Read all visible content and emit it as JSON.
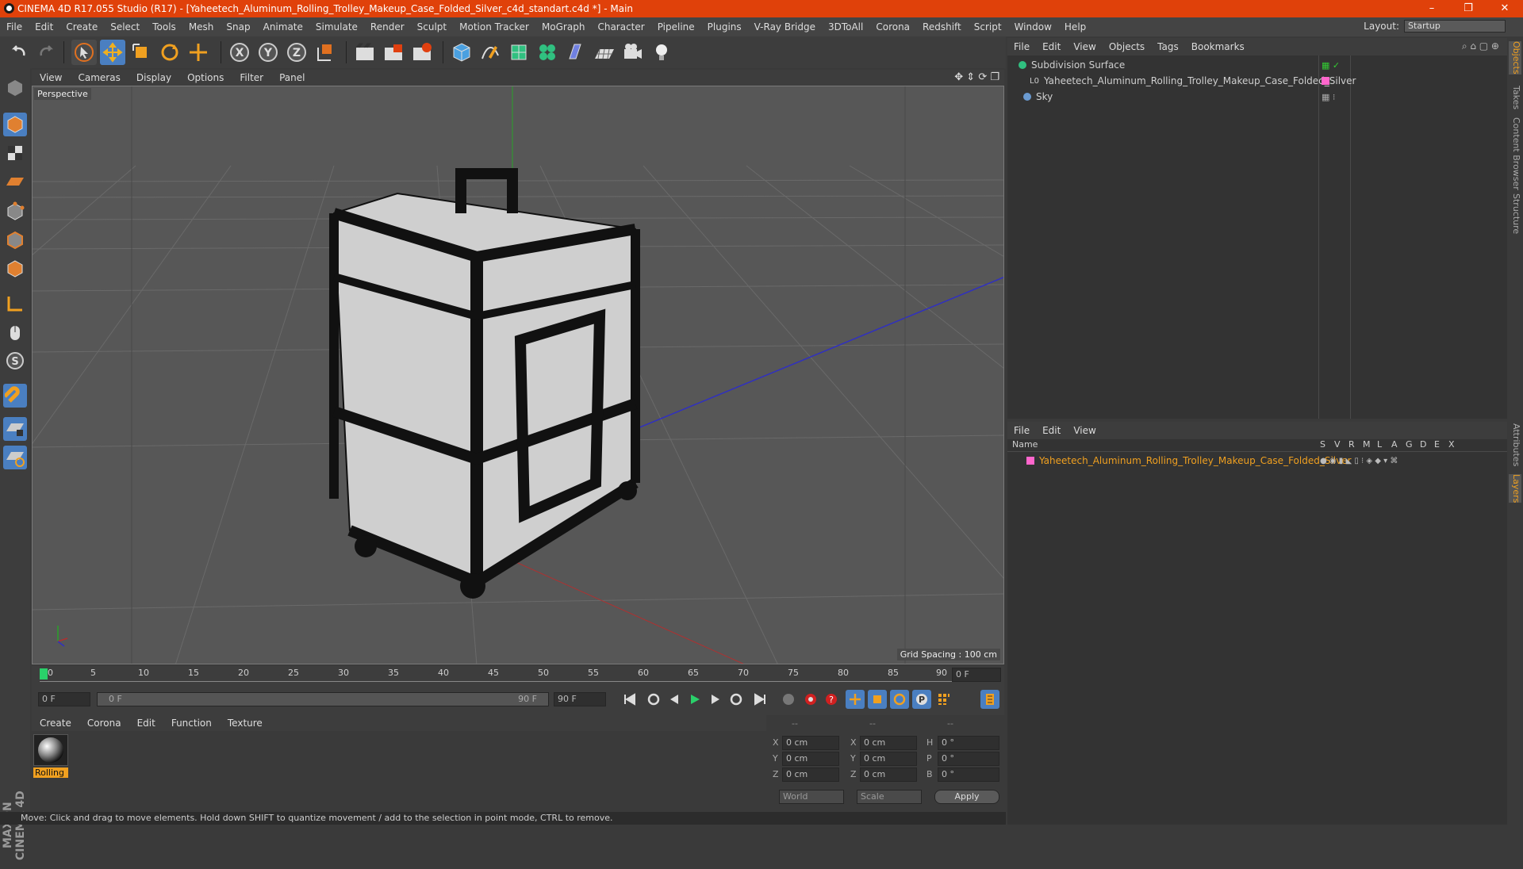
{
  "window": {
    "title": "CINEMA 4D R17.055 Studio (R17) - [Yaheetech_Aluminum_Rolling_Trolley_Makeup_Case_Folded_Silver_c4d_standart.c4d *] - Main",
    "minimize": "–",
    "restore": "❐",
    "close": "✕"
  },
  "menubar": {
    "items": [
      "File",
      "Edit",
      "Create",
      "Select",
      "Tools",
      "Mesh",
      "Snap",
      "Animate",
      "Simulate",
      "Render",
      "Sculpt",
      "Motion Tracker",
      "MoGraph",
      "Character",
      "Pipeline",
      "Plugins",
      "V-Ray Bridge",
      "3DToAll",
      "Corona",
      "Redshift",
      "Script",
      "Window",
      "Help"
    ],
    "layout_label": "Layout:",
    "layout_value": "Startup"
  },
  "viewport": {
    "menu": [
      "View",
      "Cameras",
      "Display",
      "Options",
      "Filter",
      "Panel"
    ],
    "camera_label": "Perspective",
    "grid_spacing": "Grid Spacing : 100 cm"
  },
  "timeline": {
    "ticks": [
      "0",
      "5",
      "10",
      "15",
      "20",
      "25",
      "30",
      "35",
      "40",
      "45",
      "50",
      "55",
      "60",
      "65",
      "70",
      "75",
      "80",
      "85",
      "90"
    ],
    "end_frame_field": "0 F"
  },
  "playback": {
    "current_frame": "0 F",
    "range_start": "0 F",
    "range_end": "90 F",
    "max_frame": "90 F"
  },
  "material_manager": {
    "menu": [
      "Create",
      "Corona",
      "Edit",
      "Function",
      "Texture"
    ],
    "materials": [
      {
        "name": "Rolling"
      }
    ]
  },
  "coordinates": {
    "headers": [
      "--",
      "--",
      "--"
    ],
    "rows": [
      {
        "a_label": "X",
        "a_val": "0 cm",
        "b_label": "X",
        "b_val": "0 cm",
        "c_label": "H",
        "c_val": "0 °"
      },
      {
        "a_label": "Y",
        "a_val": "0 cm",
        "b_label": "Y",
        "b_val": "0 cm",
        "c_label": "P",
        "c_val": "0 °"
      },
      {
        "a_label": "Z",
        "a_val": "0 cm",
        "b_label": "Z",
        "b_val": "0 cm",
        "c_label": "B",
        "c_val": "0 °"
      }
    ],
    "mode1": "World",
    "mode2": "Scale",
    "apply": "Apply"
  },
  "status": "Move: Click and drag to move elements. Hold down SHIFT to quantize movement / add to the selection in point mode, CTRL to remove.",
  "object_manager": {
    "menu": [
      "File",
      "Edit",
      "View",
      "Objects",
      "Tags",
      "Bookmarks"
    ],
    "objects": [
      {
        "name": "Subdivision Surface",
        "color": "#ccc"
      },
      {
        "name": "Yaheetech_Aluminum_Rolling_Trolley_Makeup_Case_Folded_Silver",
        "color": "#ddd"
      },
      {
        "name": "Sky",
        "color": "#ccc"
      }
    ]
  },
  "layer_manager": {
    "menu": [
      "File",
      "Edit",
      "View"
    ],
    "columns": [
      "Name",
      "S",
      "V",
      "R",
      "M",
      "L",
      "A",
      "G",
      "D",
      "E",
      "X"
    ],
    "layers": [
      {
        "name": "Yaheetech_Aluminum_Rolling_Trolley_Makeup_Case_Folded_Silver",
        "color": "#f0a020"
      }
    ]
  },
  "right_tabs": [
    "Objects",
    "Takes",
    "Content Browser",
    "Structure",
    "Attributes",
    "Layers"
  ],
  "brand": "MAXON CINEMA 4D",
  "colors": {
    "titlebar": "#e0410a",
    "accent_orange": "#f0a020",
    "tool_blue": "#4a7fc1"
  }
}
